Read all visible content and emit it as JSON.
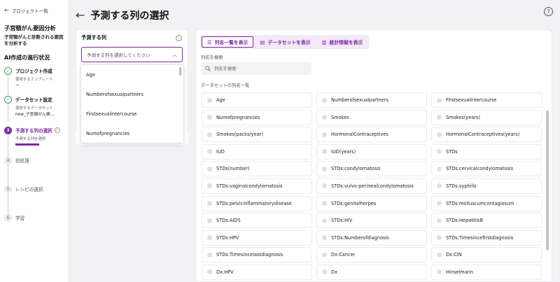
{
  "sidebar": {
    "back_label": "プロジェクト一覧",
    "project_title": "子宮頸がん要因分析",
    "project_desc": "子宮頸がんと診断される要因を分析する",
    "progress_title": "AI作成の進行状況",
    "steps": [
      {
        "num": "✓",
        "name": "プロジェクト作成",
        "sub": "使用するテンプレート",
        "value": "ー"
      },
      {
        "num": "✓",
        "name": "データセット設定",
        "sub": "使用するデータセット",
        "value": "new_子宮頸がん検..."
      },
      {
        "num": "3",
        "name": "予測する列の選択",
        "sub": "予測する列を選択"
      },
      {
        "num": "4",
        "name": "前処理"
      },
      {
        "num": "5",
        "name": "レシピの選択"
      },
      {
        "num": "6",
        "name": "学習"
      }
    ]
  },
  "header": {
    "title": "予測する列の選択"
  },
  "target": {
    "label": "予測する列",
    "placeholder": "予測する列を選択してください",
    "dropdown": [
      "Age",
      "Numberofsexualpartners",
      "Firstsexualintercourse",
      "Numofpregnancies"
    ]
  },
  "tabs": [
    {
      "label": "列名一覧を表示",
      "icon": "☰"
    },
    {
      "label": "データセットを表示",
      "icon": "▤"
    },
    {
      "label": "統計情報を表示",
      "icon": "▥"
    }
  ],
  "search": {
    "label": "列名を検索",
    "placeholder": "列名を検索"
  },
  "columns_label": "データセットの列名一覧",
  "columns": [
    "Age",
    "Numberofsexualpartners",
    "Firstsexualintercourse",
    "Numofpregnancies",
    "Smokes",
    "Smokes(years)",
    "Smokes(packs/year)",
    "HormonalContraceptives",
    "HormonalContraceptives(years)",
    "IUD",
    "IUD(years)",
    "STDs",
    "STDs(number)",
    "STDs:condylomatosis",
    "STDs:cervicalcondylomatosis",
    "STDs:vaginalcondylomatosis",
    "STDs:vulvo-perinealcondylomatosis",
    "STDs:syphilis",
    "STDs:pelvicinflammatorydisease",
    "STDs:genitalherpes",
    "STDs:molluscumcontagiosum",
    "STDs:AIDS",
    "STDs:HIV",
    "STDs:HepatitisB",
    "STDs:HPV",
    "STDs:Numberofdiagnosis",
    "STDs:Timesincefirstdiagnosis",
    "STDs:Timesincelastdiagnosis",
    "Dx:Cancer",
    "Dx:CIN",
    "Dx:HPV",
    "Dx",
    "Hinselmann"
  ]
}
